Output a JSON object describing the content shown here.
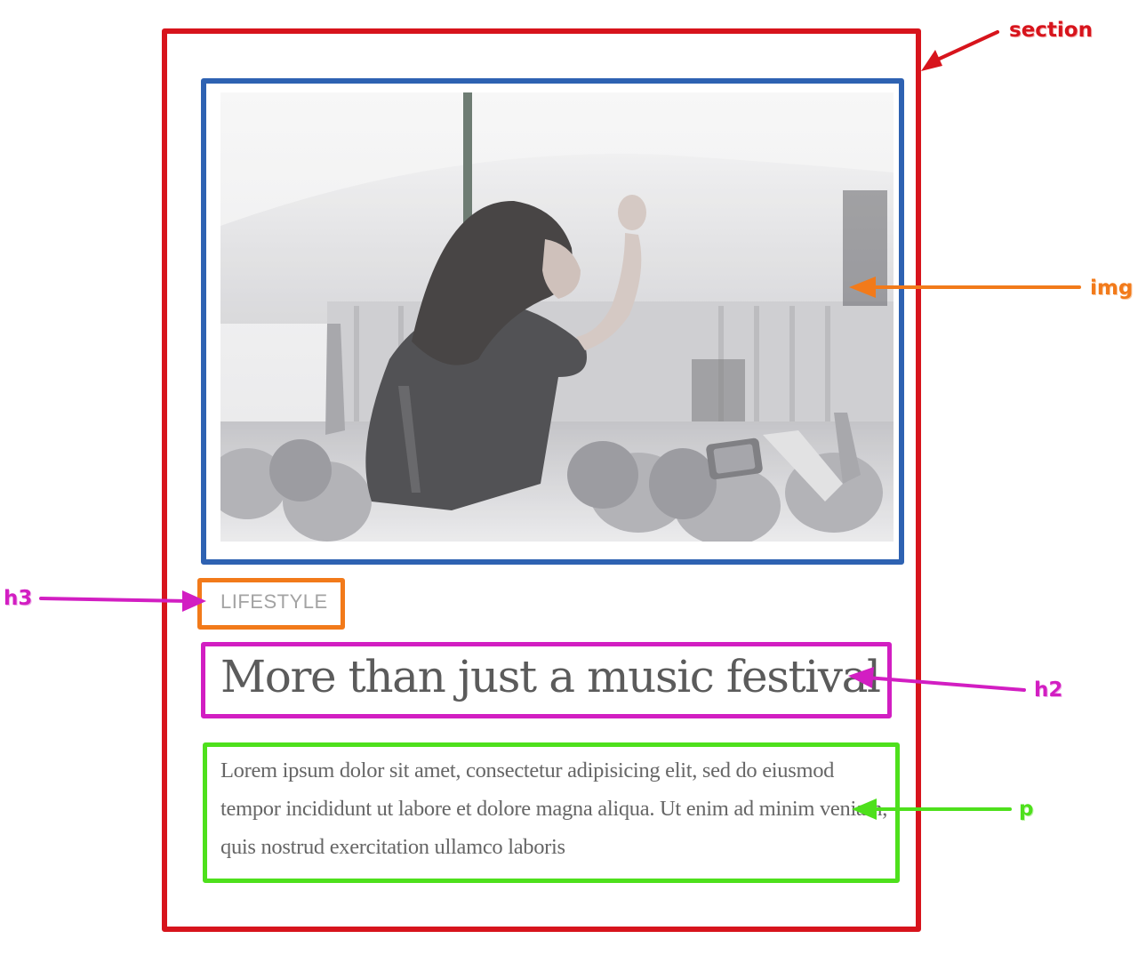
{
  "annotations": {
    "section_label": "section",
    "img_label": "img",
    "h3_label": "h3",
    "h2_label": "h2",
    "p_label": "p"
  },
  "card": {
    "category": "LIFESTYLE",
    "title": "More than just a music festival",
    "body": "Lorem ipsum dolor sit amet, consectetur adipisicing elit, sed do eiusmod tempor incididunt ut labore et dolore magna aliqua. Ut enim ad minim veniam, quis nostrud exercitation ullamco laboris"
  },
  "colors": {
    "section": "#d7141c",
    "img": "#2e62b2",
    "h3": "#f27a1a",
    "h2": "#d21ec2",
    "p": "#4ee01c"
  }
}
